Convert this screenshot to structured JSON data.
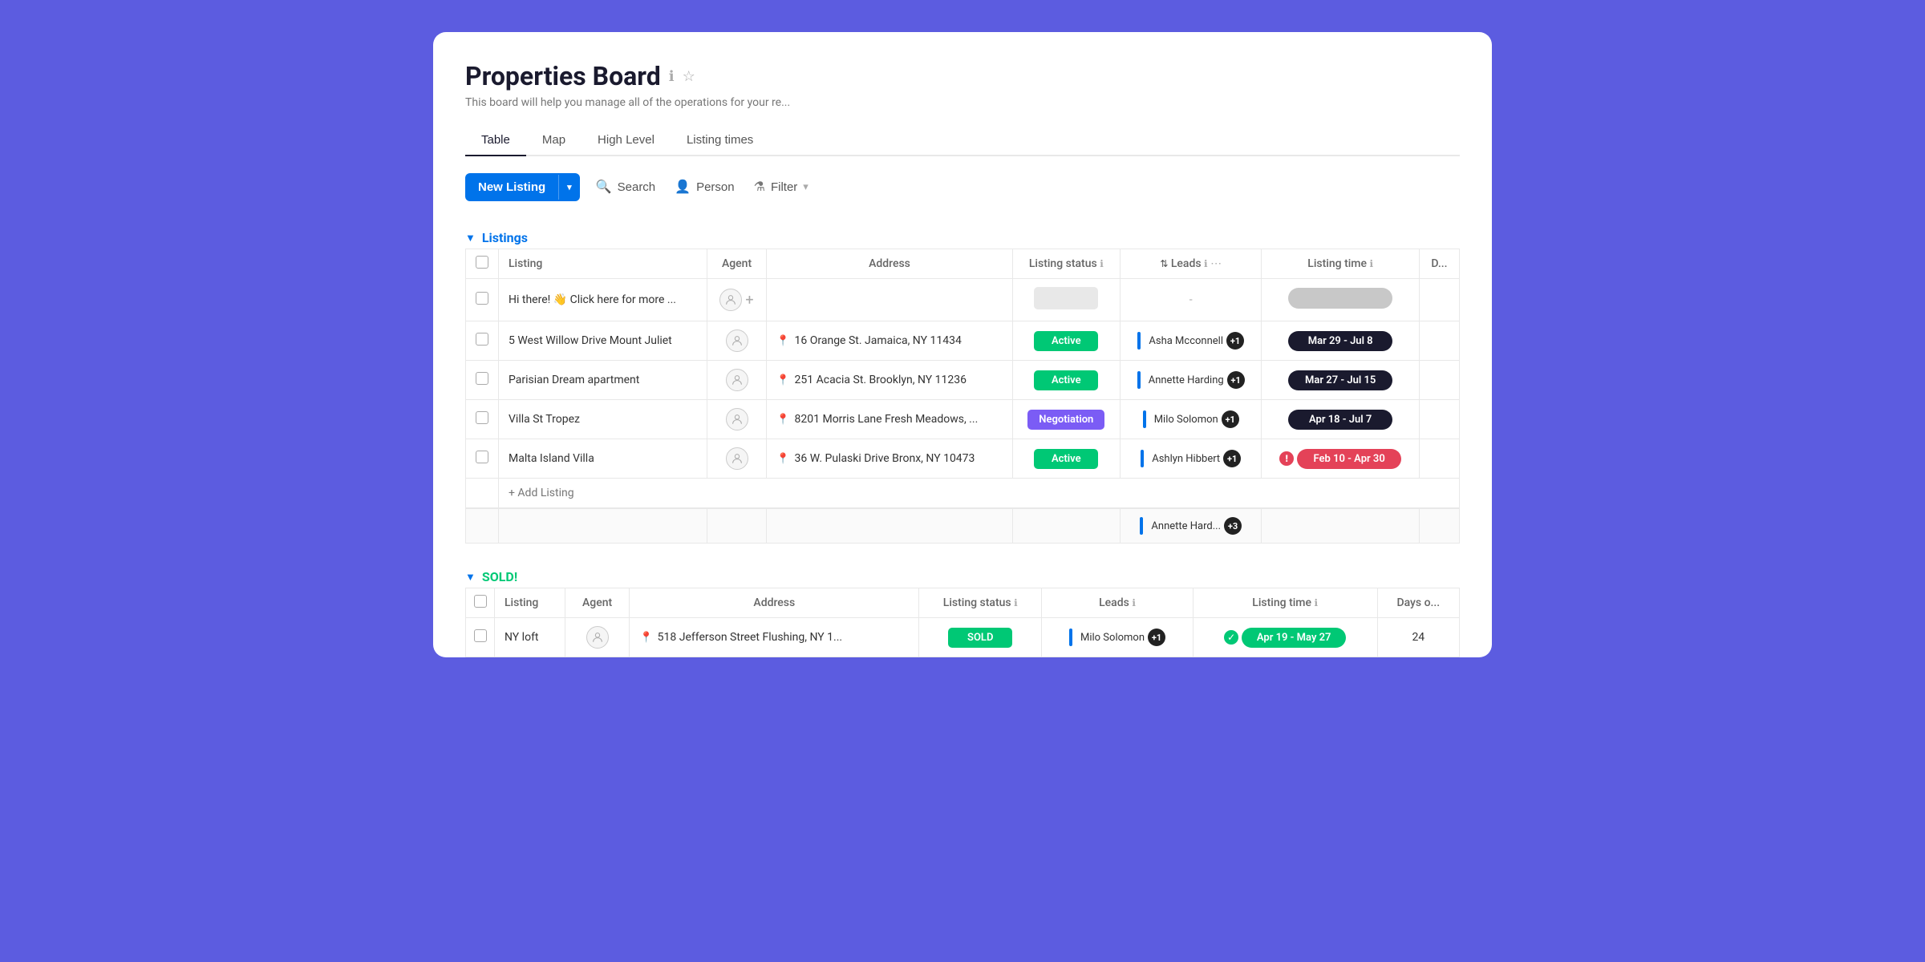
{
  "board": {
    "title": "Properties Board",
    "subtitle": "This board will help you manage all of the operations for your re...",
    "info_icon": "ℹ",
    "star_icon": "☆"
  },
  "tabs": [
    {
      "label": "Table",
      "active": true
    },
    {
      "label": "Map",
      "active": false
    },
    {
      "label": "High Level",
      "active": false
    },
    {
      "label": "Listing times",
      "active": false
    }
  ],
  "toolbar": {
    "new_listing_label": "New Listing",
    "search_label": "Search",
    "person_label": "Person",
    "filter_label": "Filter"
  },
  "listings_section": {
    "title": "Listings",
    "columns": [
      "Listing",
      "Agent",
      "Address",
      "Listing status",
      "Leads",
      "Listing time",
      "D..."
    ],
    "rows": [
      {
        "listing": "Hi there! 👋 Click here for more ...",
        "agent": "",
        "address": "",
        "status": "",
        "leads": "-",
        "listing_time": "-",
        "days": ""
      },
      {
        "listing": "5 West Willow Drive Mount Juliet",
        "agent": "",
        "address": "16 Orange St. Jamaica, NY 11434",
        "status": "Active",
        "status_type": "active",
        "leads_name": "Asha Mcconnell",
        "leads_extra": "+1",
        "listing_time": "Mar 29 - Jul 8",
        "time_type": "active",
        "days": ""
      },
      {
        "listing": "Parisian Dream apartment",
        "agent": "",
        "address": "251 Acacia St. Brooklyn, NY 11236",
        "status": "Active",
        "status_type": "active",
        "leads_name": "Annette Harding",
        "leads_extra": "+1",
        "listing_time": "Mar 27 - Jul 15",
        "time_type": "active",
        "days": ""
      },
      {
        "listing": "Villa St Tropez",
        "agent": "",
        "address": "8201 Morris Lane Fresh Meadows, ...",
        "status": "Negotiation",
        "status_type": "negotiation",
        "leads_name": "Milo Solomon",
        "leads_extra": "+1",
        "listing_time": "Apr 18 - Jul 7",
        "time_type": "active",
        "days": ""
      },
      {
        "listing": "Malta Island Villa",
        "agent": "",
        "address": "36 W. Pulaski Drive Bronx, NY 10473",
        "status": "Active",
        "status_type": "active",
        "leads_name": "Ashlyn Hibbert",
        "leads_extra": "+1",
        "listing_time": "Feb 10 - Apr 30",
        "time_type": "overdue",
        "days": ""
      }
    ],
    "add_row_label": "+ Add Listing",
    "summary_leads": "Annette Hard...",
    "summary_leads_extra": "+3"
  },
  "sold_section": {
    "title": "SOLD!",
    "columns": [
      "Listing",
      "Agent",
      "Address",
      "Listing status",
      "Leads",
      "Listing time",
      "Days o..."
    ],
    "rows": [
      {
        "listing": "NY loft",
        "agent": "",
        "address": "518 Jefferson Street Flushing, NY 1...",
        "status": "SOLD",
        "status_type": "sold",
        "leads_name": "Milo Solomon",
        "leads_extra": "+1",
        "listing_time": "Apr 19 - May 27",
        "time_type": "green",
        "days": "24"
      }
    ]
  }
}
